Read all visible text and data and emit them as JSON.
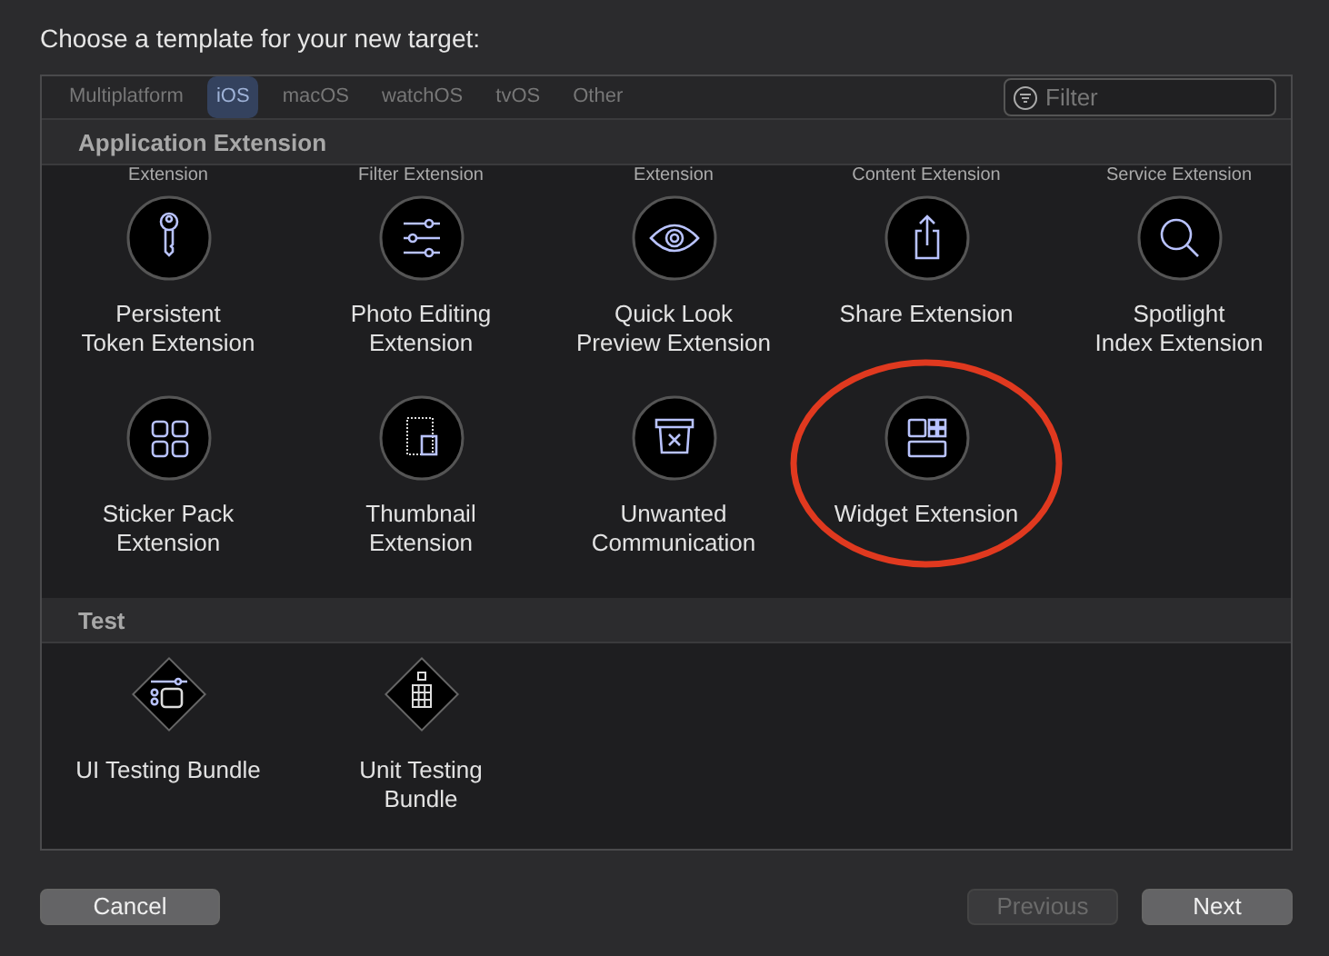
{
  "heading": "Choose a template for your new target:",
  "tabs": [
    {
      "label": "Multiplatform",
      "selected": false
    },
    {
      "label": "iOS",
      "selected": true
    },
    {
      "label": "macOS",
      "selected": false
    },
    {
      "label": "watchOS",
      "selected": false
    },
    {
      "label": "tvOS",
      "selected": false
    },
    {
      "label": "Other",
      "selected": false
    }
  ],
  "filter": {
    "placeholder": "Filter"
  },
  "sections": [
    {
      "title": "Application Extension",
      "kind": "round",
      "clipped_labels": [
        "Extension",
        "Filter Extension",
        "Extension",
        "Content Extension",
        "Service Extension"
      ],
      "items": [
        {
          "label": "Persistent\nToken Extension",
          "kind": "key",
          "highlighted": false
        },
        {
          "label": "Photo Editing\nExtension",
          "kind": "sliders",
          "highlighted": false
        },
        {
          "label": "Quick Look\nPreview Extension",
          "kind": "eye",
          "highlighted": false
        },
        {
          "label": "Share Extension",
          "kind": "share",
          "highlighted": false
        },
        {
          "label": "Spotlight\nIndex Extension",
          "kind": "search",
          "highlighted": false
        },
        {
          "label": "Sticker Pack\nExtension",
          "kind": "grid",
          "highlighted": false
        },
        {
          "label": "Thumbnail\nExtension",
          "kind": "thumbnail",
          "highlighted": false
        },
        {
          "label": "Unwanted\nCommunication",
          "kind": "bin",
          "highlighted": false
        },
        {
          "label": "Widget Extension",
          "kind": "widget",
          "highlighted": true
        }
      ]
    },
    {
      "title": "Test",
      "kind": "diamond",
      "items": [
        {
          "label": "UI Testing Bundle",
          "kind": "uitest",
          "highlighted": false
        },
        {
          "label": "Unit Testing\nBundle",
          "kind": "unittest",
          "highlighted": false
        }
      ]
    }
  ],
  "buttons": [
    {
      "label": "Cancel",
      "disabled": false
    },
    {
      "label": "Previous",
      "disabled": true
    },
    {
      "label": "Next",
      "disabled": false
    }
  ]
}
